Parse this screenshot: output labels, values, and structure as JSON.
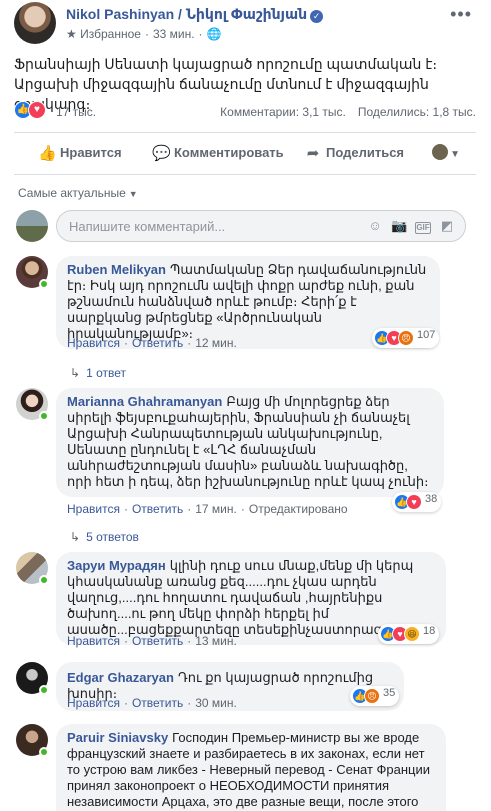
{
  "post": {
    "page_name": "Nikol Pashinyan / Նիկոլ Փաշինյան",
    "verified_icon": "verified-badge-icon",
    "favorites_label": "Избранное",
    "time": "33 мин.",
    "audience_icon": "globe-icon",
    "text": "Ֆրանսիայի Սենատի կայացրած որոշումը պատմական է։ Արցախի միջազգային ճանաչումը մտնում է միջազգային օրակարգ։",
    "reactions_count": "17 тыс.",
    "comments_stat": "Комментарии: 3,1 тыс.",
    "shares_stat": "Поделились: 1,8 тыс."
  },
  "actions": {
    "like_label": "Нравится",
    "comment_label": "Комментировать",
    "share_label": "Поделиться"
  },
  "sort_label": "Самые актуальные",
  "composer": {
    "placeholder": "Напишите комментарий..."
  },
  "comments": [
    {
      "author": "Ruben Melikyan",
      "text": "Պատմականը Ձեր դավաճանությունն էր։ Իսկ այդ որոշումն ավելի փոքր արժեք ունի, քան թշնամուն հանձնված որևէ թումբ։ Հերի՛ք է սարքկանց թմրեցնեք «Արծրունական իրականությամբ»։",
      "reaction_count": "107",
      "like": "Нравится",
      "reply": "Ответить",
      "time": "12 мин.",
      "replies": "1 ответ"
    },
    {
      "author": "Marianna Ghahramanyan",
      "text": "Բայց մի մոլորեցրեք ձեր սիրելի ֆեյսբուքահայերին, Ֆրանսիան չի ճանաչել Արցախի Հանրապետության անկախությունը, Սենատը ընդունել է «ԼՂՀ ճանաչման անհրաժեշտության մասին» բանաձև նախագիծը, որի հետ ի դեպ, ձեր իշխանությունը որևէ կապ չունի։",
      "reaction_count": "38",
      "like": "Нравится",
      "reply": "Ответить",
      "time": "17 мин.",
      "edited": "Отредактировано",
      "replies": "5 ответов"
    },
    {
      "author": "Заруи Мурадян",
      "text": "կլինի դուք սուս մնաք,մենք մի կերպ կհասկանանք առանց քեզ......դու չկաս արդեն վաղուց,....դու հողատու դավաճան ,հայրենիքս ծախող....ու թող մեկը փորձի հերքել իմ ասածը...բացեքքարտեզը տեսեքինչաստորագրել",
      "reaction_count": "18",
      "like": "Нравится",
      "reply": "Ответить",
      "time": "13 мин."
    },
    {
      "author": "Edgar Ghazaryan",
      "text": "Դու քո կայացրած որոշումից խոսիր։",
      "reaction_count": "35",
      "like": "Нравится",
      "reply": "Ответить",
      "time": "30 мин."
    },
    {
      "author": "Paruir Siniavsky",
      "text": "Господин Премьер-министр вы же вроде французский знаете и разбираетесь в их законах, если нет то устрою вам ликбез - Неверный перевод - Сенат Франции принял законопроект о НЕОБХОДИМОСТИ принятия независимости Арцаха, это две разные вещи, после этого"
    }
  ],
  "colors": {
    "link": "#385898",
    "like_blue": "#1877f2",
    "love_red": "#f33e58",
    "online_green": "#42b72a"
  }
}
